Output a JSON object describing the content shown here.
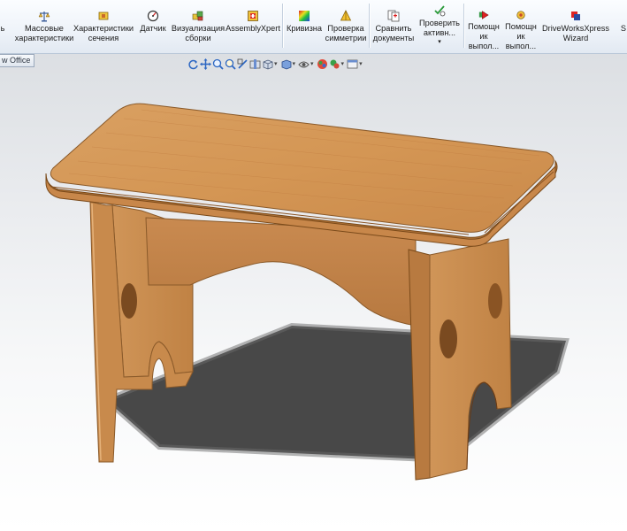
{
  "toolbar": {
    "buttons": [
      {
        "id": "partial",
        "label": "ь"
      },
      {
        "id": "mass",
        "label": "Массовые\nхарактеристики"
      },
      {
        "id": "section",
        "label": "Характеристики\nсечения"
      },
      {
        "id": "sensor",
        "label": "Датчик"
      },
      {
        "id": "assembly_vis",
        "label": "Визуализация\nсборки"
      },
      {
        "id": "assemblyxpert",
        "label": "AssemblyXpert"
      },
      {
        "id": "curvature",
        "label": "Кривизна"
      },
      {
        "id": "symmetry",
        "label": "Проверка\nсимметрии"
      },
      {
        "id": "compare",
        "label": "Сравнить\nдокументы"
      },
      {
        "id": "check_active",
        "label": "Проверить\nактивн..."
      },
      {
        "id": "helper1",
        "label": "Помощн\nик\nвыпол..."
      },
      {
        "id": "helper2",
        "label": "Помощн\nик\nвыпол..."
      },
      {
        "id": "driveworks",
        "label": "DriveWorksXpress\nWizard"
      },
      {
        "id": "cut",
        "label": "S"
      }
    ]
  },
  "tab": {
    "label": "w Office"
  },
  "colors": {
    "ribbon_bg": "#eef3f9",
    "wood_top": "#d49858",
    "wood_side": "#c98a50",
    "wood_edge": "#9c6734",
    "shadow": "#3a3a3a"
  },
  "hud_icons": [
    "rotate-icon",
    "pan-icon",
    "zoom-icon",
    "zoom-area-icon",
    "zoom-fit-icon",
    "section-view-icon",
    "view-orientation-icon",
    "display-style-icon",
    "hide-show-icon",
    "appearance-icon",
    "scene-icon",
    "view-settings-icon"
  ]
}
